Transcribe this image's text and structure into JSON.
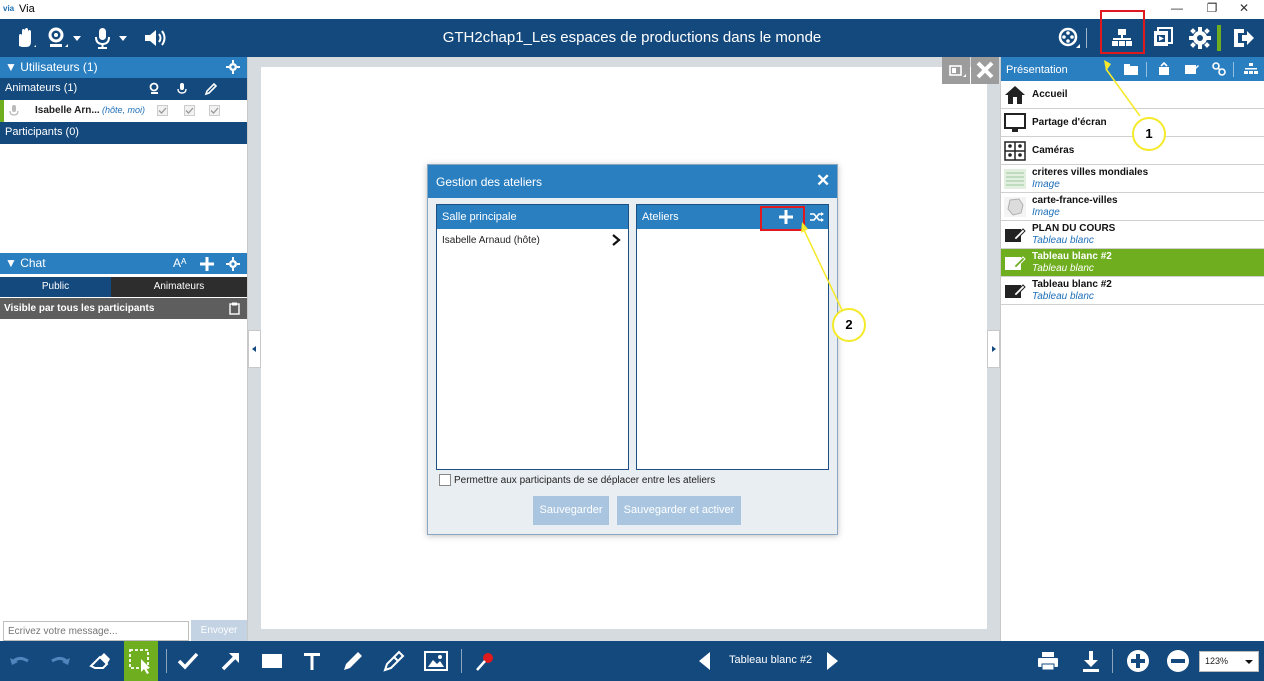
{
  "os_window": {
    "logo": "via",
    "title": "Via",
    "minimize": "—",
    "restore": "❐",
    "close": "✕"
  },
  "top_bar": {
    "title": "GTH2chap1_Les espaces de productions dans le monde"
  },
  "users_panel": {
    "header": "▼ Utilisateurs (1)",
    "animators_header": "Animateurs (1)",
    "animator_name": "Isabelle Arn...",
    "animator_role": "(hôte, moi)",
    "participants_header": "Participants (0)"
  },
  "chat_panel": {
    "header": "▼ Chat",
    "font_size_label": "Aᴬ",
    "tab_public": "Public",
    "tab_animators": "Animateurs",
    "visibility": "Visible par tous les participants",
    "input_placeholder": "Écrivez votre message...",
    "send_label": "Envoyer"
  },
  "presentation_panel": {
    "header": "Présentation",
    "items": [
      {
        "title": "Accueil",
        "subtitle": ""
      },
      {
        "title": "Partage d'écran",
        "subtitle": ""
      },
      {
        "title": "Caméras",
        "subtitle": ""
      },
      {
        "title": "criteres villes mondiales",
        "subtitle": "Image"
      },
      {
        "title": "carte-france-villes",
        "subtitle": "Image"
      },
      {
        "title": "PLAN DU COURS",
        "subtitle": "Tableau blanc"
      },
      {
        "title": "Tableau blanc #2",
        "subtitle": "Tableau blanc"
      },
      {
        "title": "Tableau blanc #2",
        "subtitle": "Tableau blanc"
      }
    ],
    "selected_color": "#6fae1f"
  },
  "modal": {
    "title": "Gestion des ateliers",
    "close": "✕",
    "main_room_header": "Salle principale",
    "main_room_member": "Isabelle Arnaud (hôte)",
    "workshops_header": "Ateliers",
    "checkbox_label": "Permettre aux participants de se déplacer entre les ateliers",
    "save_label": "Sauvegarder",
    "save_activate_label": "Sauvegarder et activer"
  },
  "bottom_bar": {
    "page_label": "Tableau blanc #2",
    "zoom": "123%"
  },
  "annotations": {
    "marker_1": "1",
    "marker_2": "2",
    "annotation_color": "#e0191e",
    "marker_color": "#f5ea2a"
  },
  "colors": {
    "dark_blue": "#14497d",
    "mid_blue": "#2a7fc1",
    "accent_green": "#6fae1f"
  }
}
